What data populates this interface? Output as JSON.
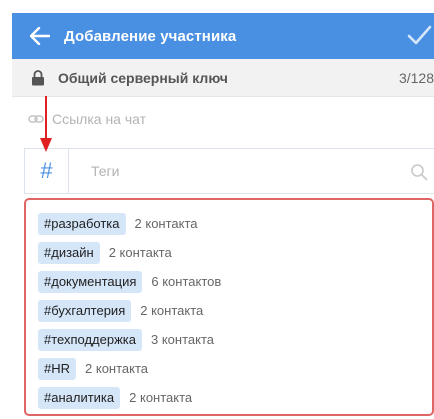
{
  "header": {
    "title": "Добавление участника"
  },
  "key_row": {
    "label": "Общий серверный ключ",
    "count": "3/128"
  },
  "link_row": {
    "label": "Ссылка на чат"
  },
  "tags_input": {
    "placeholder": "Теги",
    "value": ""
  },
  "tags": [
    {
      "name": "#разработка",
      "count": "2 контакта"
    },
    {
      "name": "#дизайн",
      "count": "2 контакта"
    },
    {
      "name": "#документация",
      "count": "6 контактов"
    },
    {
      "name": "#бухгалтерия",
      "count": "2 контакта"
    },
    {
      "name": "#техподдержка",
      "count": "3 контакта"
    },
    {
      "name": "#HR",
      "count": "2 контакта"
    },
    {
      "name": "#аналитика",
      "count": "2 контакта"
    }
  ],
  "colors": {
    "header": "#4a90e2",
    "accent": "#4a90e2",
    "chip": "#d6e6f9",
    "highlight_border": "#e06666",
    "arrow": "#e02020"
  },
  "icons": [
    "arrow-left-icon",
    "check-icon",
    "lock-icon",
    "link-icon",
    "hash-icon",
    "search-icon",
    "annotation-arrow-icon"
  ]
}
